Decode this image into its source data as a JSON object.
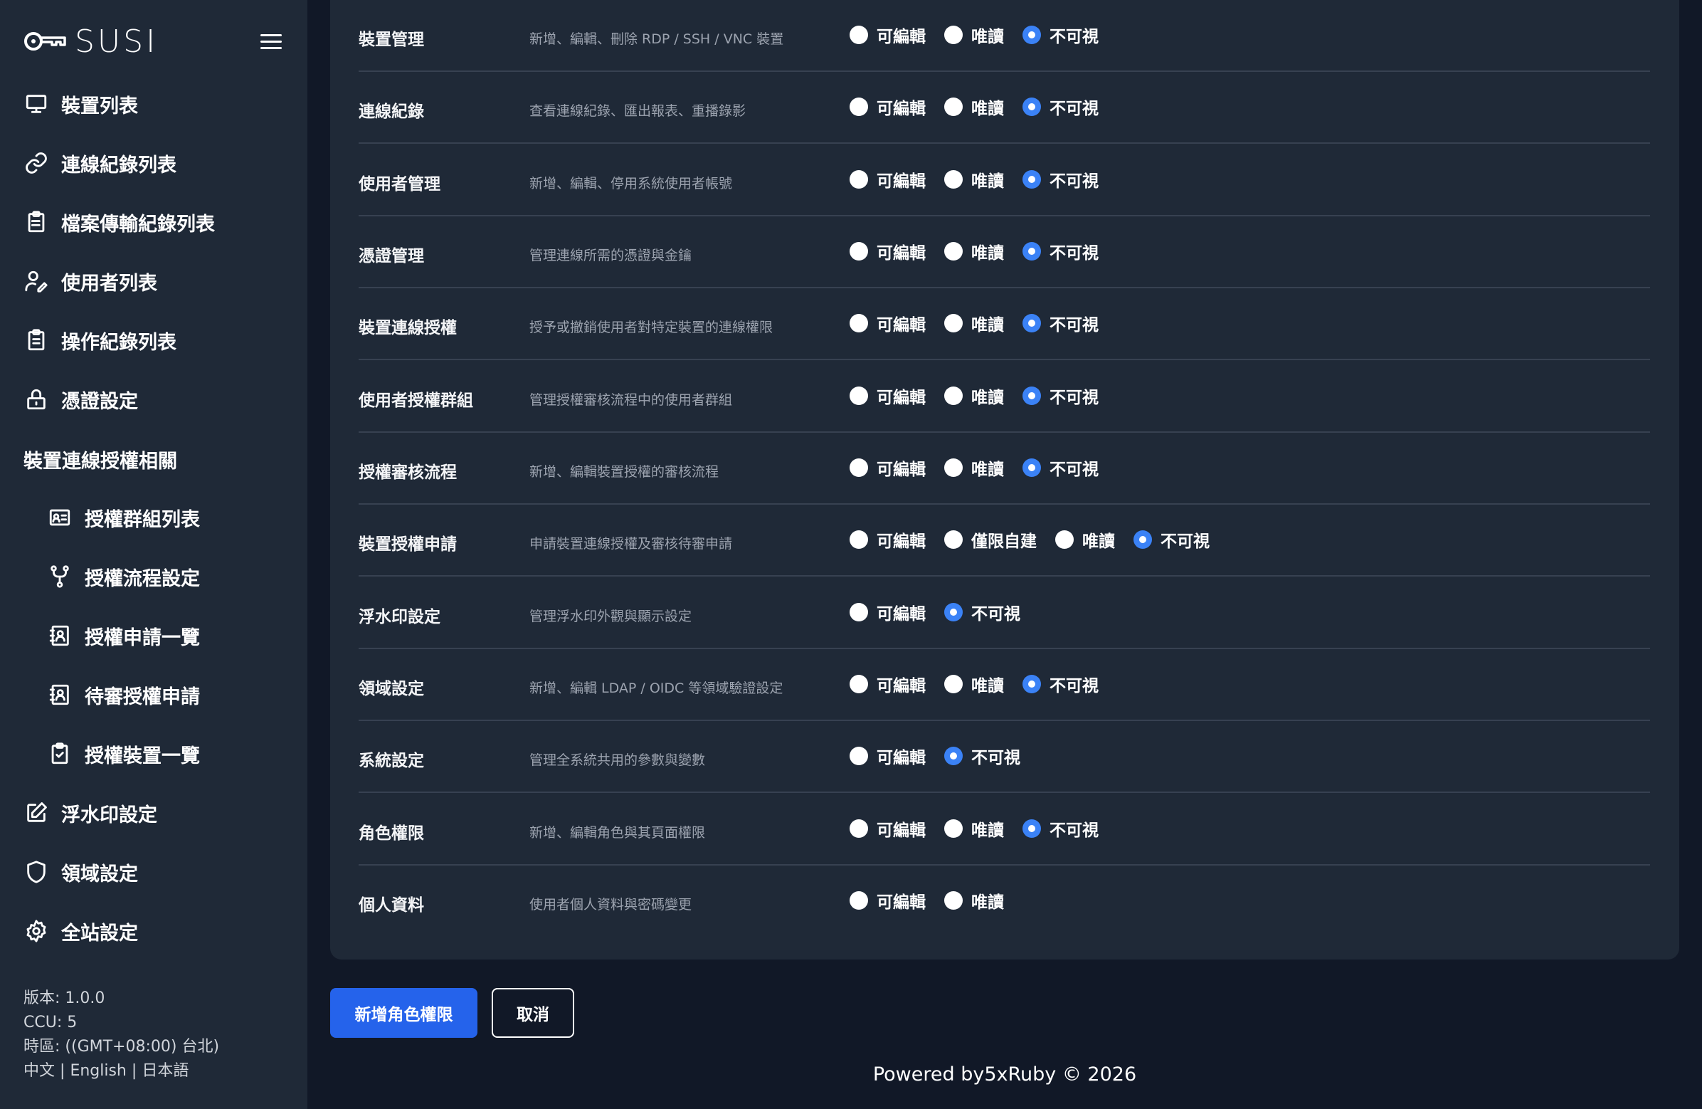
{
  "brand": {
    "logo_text": "SUSI"
  },
  "sidebar": {
    "items": [
      {
        "label": "裝置列表",
        "icon": "monitor-icon"
      },
      {
        "label": "連線紀錄列表",
        "icon": "link-icon"
      },
      {
        "label": "檔案傳輸紀錄列表",
        "icon": "clipboard-list-icon"
      },
      {
        "label": "使用者列表",
        "icon": "users-icon"
      },
      {
        "label": "操作紀錄列表",
        "icon": "clipboard-icon"
      },
      {
        "label": "憑證設定",
        "icon": "lock-icon"
      }
    ],
    "group_label": "裝置連線授權相關",
    "sub_items": [
      {
        "label": "授權群組列表",
        "icon": "id-card-icon"
      },
      {
        "label": "授權流程設定",
        "icon": "git-fork-icon"
      },
      {
        "label": "授權申請一覽",
        "icon": "contact-book-icon"
      },
      {
        "label": "待審授權申請",
        "icon": "contact-book-icon"
      },
      {
        "label": "授權裝置一覽",
        "icon": "clipboard-check-icon"
      }
    ],
    "bottom_items": [
      {
        "label": "浮水印設定",
        "icon": "edit-icon"
      },
      {
        "label": "領域設定",
        "icon": "shield-icon"
      },
      {
        "label": "全站設定",
        "icon": "gear-icon"
      }
    ],
    "meta": {
      "version": "版本: 1.0.0",
      "ccu": "CCU: 5",
      "timezone": "時區: ((GMT+08:00) 台北)",
      "lang_zh": "中文",
      "lang_en": "English",
      "lang_ja": "日本語",
      "sep": "|"
    }
  },
  "permissions": [
    {
      "name": "裝置管理",
      "desc": "新增、編輯、刪除 RDP / SSH / VNC 裝置",
      "options": [
        "可編輯",
        "唯讀",
        "不可視"
      ],
      "selected": 2
    },
    {
      "name": "連線紀錄",
      "desc": "查看連線紀錄、匯出報表、重播錄影",
      "options": [
        "可編輯",
        "唯讀",
        "不可視"
      ],
      "selected": 2
    },
    {
      "name": "使用者管理",
      "desc": "新增、編輯、停用系統使用者帳號",
      "options": [
        "可編輯",
        "唯讀",
        "不可視"
      ],
      "selected": 2
    },
    {
      "name": "憑證管理",
      "desc": "管理連線所需的憑證與金鑰",
      "options": [
        "可編輯",
        "唯讀",
        "不可視"
      ],
      "selected": 2
    },
    {
      "name": "裝置連線授權",
      "desc": "授予或撤銷使用者對特定裝置的連線權限",
      "options": [
        "可編輯",
        "唯讀",
        "不可視"
      ],
      "selected": 2
    },
    {
      "name": "使用者授權群組",
      "desc": "管理授權審核流程中的使用者群組",
      "options": [
        "可編輯",
        "唯讀",
        "不可視"
      ],
      "selected": 2
    },
    {
      "name": "授權審核流程",
      "desc": "新增、編輯裝置授權的審核流程",
      "options": [
        "可編輯",
        "唯讀",
        "不可視"
      ],
      "selected": 2
    },
    {
      "name": "裝置授權申請",
      "desc": "申請裝置連線授權及審核待審申請",
      "options": [
        "可編輯",
        "僅限自建",
        "唯讀",
        "不可視"
      ],
      "selected": 3
    },
    {
      "name": "浮水印設定",
      "desc": "管理浮水印外觀與顯示設定",
      "options": [
        "可編輯",
        "不可視"
      ],
      "selected": 1
    },
    {
      "name": "領域設定",
      "desc": "新增、編輯 LDAP / OIDC 等領域驗證設定",
      "options": [
        "可編輯",
        "唯讀",
        "不可視"
      ],
      "selected": 2
    },
    {
      "name": "系統設定",
      "desc": "管理全系統共用的參數與變數",
      "options": [
        "可編輯",
        "不可視"
      ],
      "selected": 1
    },
    {
      "name": "角色權限",
      "desc": "新增、編輯角色與其頁面權限",
      "options": [
        "可編輯",
        "唯讀",
        "不可視"
      ],
      "selected": 2
    },
    {
      "name": "個人資料",
      "desc": "使用者個人資料與密碼變更",
      "options": [
        "可編輯",
        "唯讀"
      ],
      "selected": -1
    }
  ],
  "actions": {
    "submit_label": "新增角色權限",
    "cancel_label": "取消"
  },
  "footer": {
    "text": "Powered by5xRuby © 2026"
  },
  "colors": {
    "sidebar_bg": "#1f2937",
    "page_bg": "#111827",
    "accent": "#2563eb",
    "radio_checked": "#3b82f6"
  }
}
